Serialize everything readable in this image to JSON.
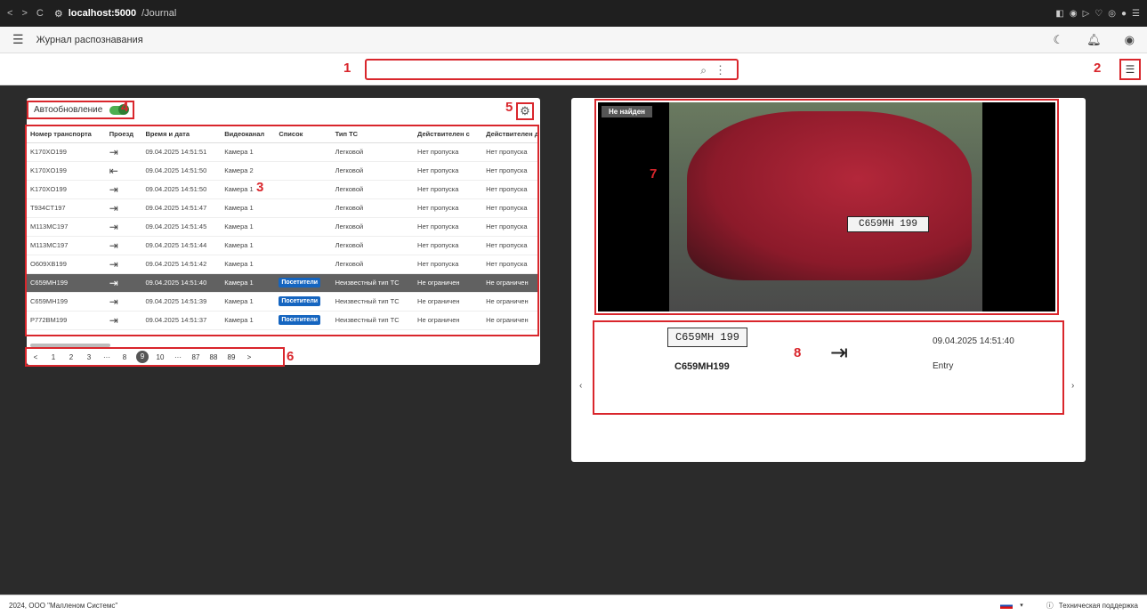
{
  "browser": {
    "back": "<",
    "forward": ">",
    "reload": "C",
    "host": "localhost:5000",
    "path": "/Journal"
  },
  "header": {
    "title": "Журнал распознавания"
  },
  "search": {
    "value": "",
    "placeholder": ""
  },
  "annotations": [
    "1",
    "2",
    "3",
    "4",
    "5",
    "6",
    "7",
    "8"
  ],
  "left_panel": {
    "autoupdate_label": "Автообновление",
    "autoupdate_on": true,
    "columns": [
      "Номер транспорта",
      "Проезд",
      "Время и дата",
      "Видеоканал",
      "Список",
      "Тип ТС",
      "Действителен с",
      "Действителен д"
    ],
    "rows": [
      {
        "plate": "K170XO199",
        "dir": "in",
        "time": "09.04.2025 14:51:51",
        "channel": "Камера 1",
        "list": "",
        "type": "Легковой",
        "from": "Нет пропуска",
        "to": "Нет пропуска",
        "selected": false
      },
      {
        "plate": "K170XO199",
        "dir": "out",
        "time": "09.04.2025 14:51:50",
        "channel": "Камера 2",
        "list": "",
        "type": "Легковой",
        "from": "Нет пропуска",
        "to": "Нет пропуска",
        "selected": false
      },
      {
        "plate": "K170XO199",
        "dir": "in",
        "time": "09.04.2025 14:51:50",
        "channel": "Камера 1",
        "list": "",
        "type": "Легковой",
        "from": "Нет пропуска",
        "to": "Нет пропуска",
        "selected": false
      },
      {
        "plate": "T934CT197",
        "dir": "in",
        "time": "09.04.2025 14:51:47",
        "channel": "Камера 1",
        "list": "",
        "type": "Легковой",
        "from": "Нет пропуска",
        "to": "Нет пропуска",
        "selected": false
      },
      {
        "plate": "M113MC197",
        "dir": "in",
        "time": "09.04.2025 14:51:45",
        "channel": "Камера 1",
        "list": "",
        "type": "Легковой",
        "from": "Нет пропуска",
        "to": "Нет пропуска",
        "selected": false
      },
      {
        "plate": "M113MC197",
        "dir": "in",
        "time": "09.04.2025 14:51:44",
        "channel": "Камера 1",
        "list": "",
        "type": "Легковой",
        "from": "Нет пропуска",
        "to": "Нет пропуска",
        "selected": false
      },
      {
        "plate": "O609XB199",
        "dir": "in",
        "time": "09.04.2025 14:51:42",
        "channel": "Камера 1",
        "list": "",
        "type": "Легковой",
        "from": "Нет пропуска",
        "to": "Нет пропуска",
        "selected": false
      },
      {
        "plate": "C659MH199",
        "dir": "in",
        "time": "09.04.2025 14:51:40",
        "channel": "Камера 1",
        "list": "Посетители",
        "type": "Неизвестный тип ТС",
        "from": "Не ограничен",
        "to": "Не ограничен",
        "selected": true
      },
      {
        "plate": "C659MH199",
        "dir": "in",
        "time": "09.04.2025 14:51:39",
        "channel": "Камера 1",
        "list": "Посетители",
        "type": "Неизвестный тип ТС",
        "from": "Не ограничен",
        "to": "Не ограничен",
        "selected": false
      },
      {
        "plate": "P772BM199",
        "dir": "in",
        "time": "09.04.2025 14:51:37",
        "channel": "Камера 1",
        "list": "Посетители",
        "type": "Неизвестный тип ТС",
        "from": "Не ограничен",
        "to": "Не ограничен",
        "selected": false
      }
    ],
    "pager": [
      "<",
      "1",
      "2",
      "3",
      "···",
      "8",
      "9",
      "10",
      "···",
      "87",
      "88",
      "89",
      ">"
    ],
    "current_page": "9"
  },
  "right_panel": {
    "status_tag": "Не найден",
    "video_plate": "C659MH 199",
    "plate_image_text": "C659MH 199",
    "plate_text": "C659MH199",
    "timestamp": "09.04.2025 14:51:40",
    "direction": "Entry",
    "prev": "‹",
    "next": "›"
  },
  "footer": {
    "copyright": "2024, ООО \"Малленом Системс\"",
    "support": "Техническая поддержка"
  }
}
